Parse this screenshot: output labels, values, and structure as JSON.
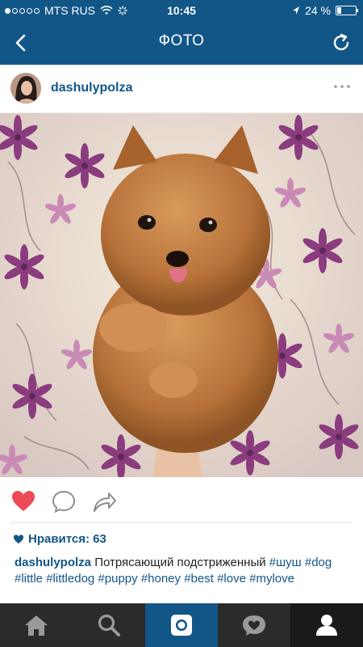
{
  "status_bar": {
    "carrier": "MTS RUS",
    "time": "10:45",
    "battery": "24 %",
    "battery_level": 0.24,
    "signal_dots_filled": 1,
    "icons": [
      "wifi-icon",
      "activity-spinner-icon",
      "location-arrow-icon",
      "battery-icon"
    ]
  },
  "nav": {
    "title": "ФОТО",
    "back_icon": "chevron-left-icon",
    "refresh_icon": "refresh-icon"
  },
  "post": {
    "username": "dashulypolza",
    "more_icon": "more-dots-icon",
    "likes_label": "Нравится: 63",
    "caption_user": "dashulypolza",
    "caption_text": "Потрясающий подстриженный",
    "hashtags": [
      "#шуш",
      "#dog",
      "#little",
      "#littledog",
      "#puppy",
      "#honey",
      "#best",
      "#love",
      "#mylove"
    ]
  },
  "actions": {
    "liked": true,
    "like_icon": "heart-icon",
    "comment_icon": "comment-bubble-icon",
    "share_icon": "share-arrow-icon"
  },
  "tabbar": {
    "tabs": [
      "home-icon",
      "search-icon",
      "camera-icon",
      "activity-heart-icon",
      "profile-icon"
    ],
    "active": "camera-icon"
  },
  "colors": {
    "brand": "#125688",
    "like": "#ed4956",
    "tabbar": "#2b2b2b"
  }
}
